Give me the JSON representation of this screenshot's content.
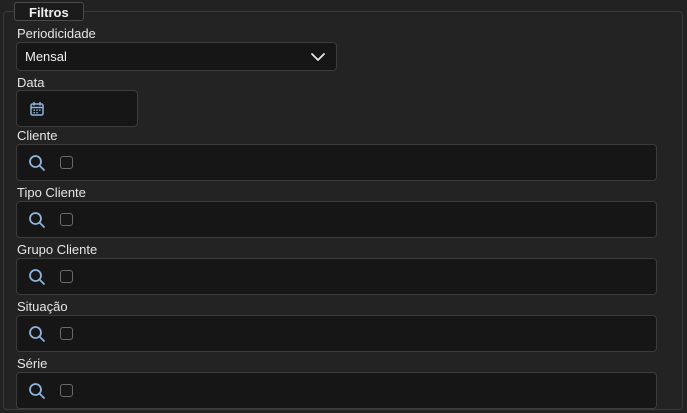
{
  "filters": {
    "legend": "Filtros",
    "periodicidade": {
      "label": "Periodicidade",
      "value": "Mensal"
    },
    "data": {
      "label": "Data",
      "value": ""
    },
    "lookups": [
      {
        "label": "Cliente"
      },
      {
        "label": "Tipo Cliente"
      },
      {
        "label": "Grupo Cliente"
      },
      {
        "label": "Situação"
      },
      {
        "label": "Série"
      }
    ]
  },
  "colors": {
    "background": "#222222",
    "field_background": "#161616",
    "icon_accent": "#8fb3d9",
    "border": "#3c3c3c"
  },
  "icons": {
    "select": "chevron-down-icon",
    "date": "calendar-icon",
    "lookup": "search-icon",
    "lookup_check": "checkbox-icon"
  }
}
